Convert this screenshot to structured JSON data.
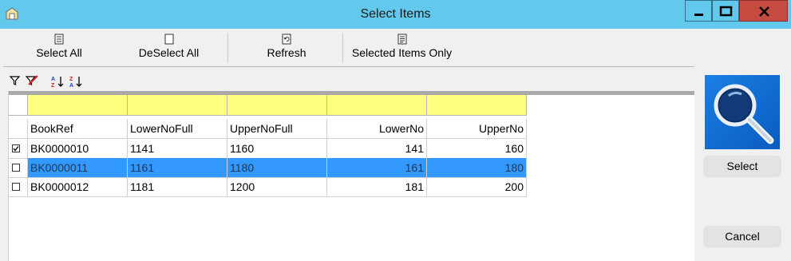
{
  "window": {
    "title": "Select Items"
  },
  "toolbar": {
    "select_all": "Select All",
    "deselect_all": "DeSelect All",
    "refresh": "Refresh",
    "selected_only": "Selected Items Only"
  },
  "grid": {
    "columns": [
      "BookRef",
      "LowerNoFull",
      "UpperNoFull",
      "LowerNo",
      "UpperNo"
    ],
    "rows": [
      {
        "checked": true,
        "selected": false,
        "cells": [
          "BK0000010",
          "1141",
          "1160",
          "141",
          "160"
        ]
      },
      {
        "checked": false,
        "selected": true,
        "cells": [
          "BK0000011",
          "1161",
          "1180",
          "161",
          "180"
        ]
      },
      {
        "checked": false,
        "selected": false,
        "cells": [
          "BK0000012",
          "1181",
          "1200",
          "181",
          "200"
        ]
      }
    ]
  },
  "side": {
    "select_label": "Select",
    "cancel_label": "Cancel"
  },
  "colors": {
    "titlebar": "#62c9ec",
    "close": "#c64b41",
    "filter": "#ffff80",
    "selected_row": "#3399ff"
  }
}
